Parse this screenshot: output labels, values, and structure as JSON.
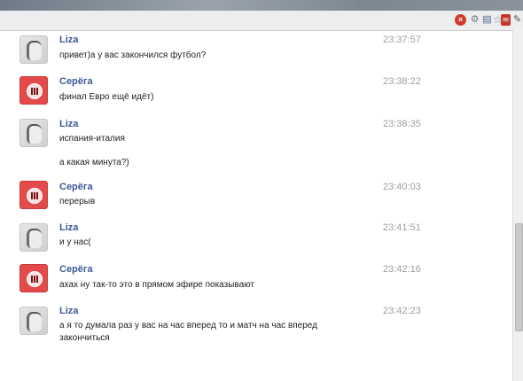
{
  "chat": {
    "messages": [
      {
        "author": "Liza",
        "time": "23:37:57",
        "lines": [
          "привет)а у вас закончился футбол?"
        ]
      },
      {
        "author": "Серёга",
        "time": "23:38:22",
        "lines": [
          "финал Евро ещё идёт)"
        ]
      },
      {
        "author": "Liza",
        "time": "23:38:35",
        "lines": [
          "испания-италия",
          "а какая минута?)"
        ]
      },
      {
        "author": "Серёга",
        "time": "23:40:03",
        "lines": [
          "перерыв"
        ]
      },
      {
        "author": "Liza",
        "time": "23:41:51",
        "lines": [
          "и у нас("
        ]
      },
      {
        "author": "Серёга",
        "time": "23:42:16",
        "lines": [
          "ахах ну так-то это в прямом эфире показывают"
        ]
      },
      {
        "author": "Liza",
        "time": "23:42:23",
        "lines": [
          "а я то думала раз у вас на час вперед то и матч на час вперед закончиться"
        ]
      }
    ]
  }
}
